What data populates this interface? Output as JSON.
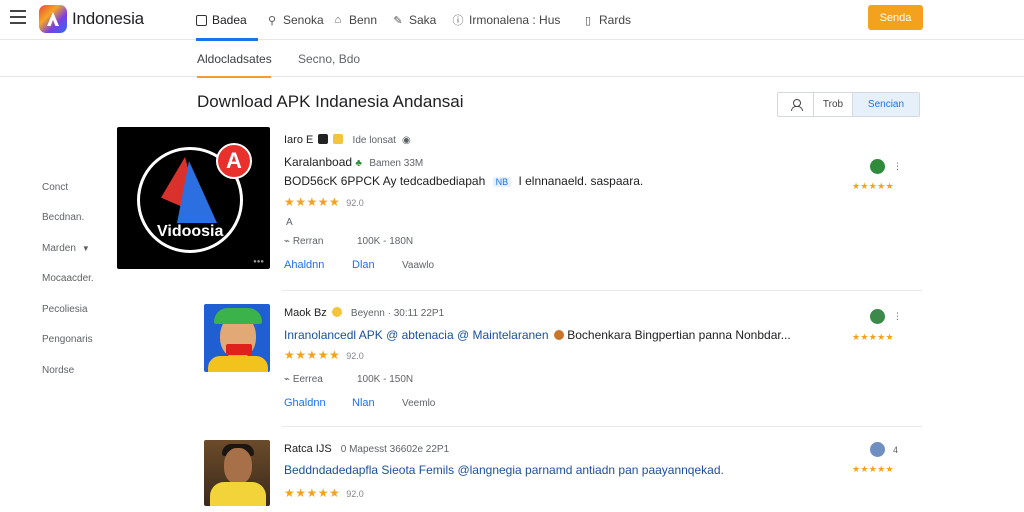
{
  "brand": {
    "name": "Indonesia"
  },
  "nav": {
    "items": [
      {
        "label": "Badea",
        "icon": "box-icon"
      },
      {
        "label": "Senoka",
        "icon": "tag-icon"
      },
      {
        "label": "Benn",
        "icon": "bell-icon"
      },
      {
        "label": "Saka",
        "icon": "pencil-icon"
      },
      {
        "label": "Irmonalena : Hus",
        "icon": "info-icon"
      },
      {
        "label": "Rards",
        "icon": "clipboard-icon"
      }
    ],
    "cta_label": "Senda"
  },
  "subtabs": [
    {
      "label": "Aldocladsates",
      "active": true
    },
    {
      "label": "Secno, Bdo",
      "active": false
    }
  ],
  "page": {
    "title": "Download APK Indanesia Andansai"
  },
  "view_buttons": [
    {
      "label": "",
      "icon": "user-icon"
    },
    {
      "label": "Trob"
    },
    {
      "label": "Sencian"
    }
  ],
  "sidebar": {
    "items": [
      {
        "label": "Conct"
      },
      {
        "label": "Becdnan."
      },
      {
        "label": "Marden",
        "has_caret": true
      },
      {
        "label": "Mocaacder."
      },
      {
        "label": "Pecoliesia"
      },
      {
        "label": "Pengonaris"
      },
      {
        "label": "Nordse"
      }
    ]
  },
  "colors": {
    "accent": "#1a73e8",
    "cta": "#f4a11d",
    "star": "#f4a11d"
  },
  "apps": [
    {
      "thumb_text": "Vidoosia",
      "thumb_badge": "A",
      "header": "Iaro E",
      "header_meta": "Ide lonsat",
      "title_line": "Karalanboad",
      "title_meta": "Bamen 33M",
      "desc": "BOD56cK 6PPCK Ay tedcadbediapah",
      "desc_chip": "NB",
      "desc_tail": "I elnnanaeld. saspaara.",
      "rating": 4.5,
      "rating_text": "★★★★★",
      "rating_num": "92.0",
      "extra_icon": "A",
      "meta_left": "Rerran",
      "meta_right": "100K - 180N",
      "link1": "Ahaldnn",
      "link2": "Dlan",
      "muted": "Vaawlo",
      "right_rating": "★★★★★",
      "right_more": "⋮",
      "avatar_color": "#2f8a3b"
    },
    {
      "header": "Maok Bz",
      "header_meta": "Beyenn · 30:11 22P1",
      "title_line": "Inranolancedl APK @ abtenacia @ Maintelaranen",
      "desc_tail": "Bochenkara Bingpertian panna Nonbdar...",
      "rating": 5,
      "rating_text": "★★★★★",
      "rating_num": "92.0",
      "meta_left": "Eerrea",
      "meta_right": "100K - 150N",
      "link1": "Ghaldnn",
      "link2": "Nlan",
      "muted": "Veemlo",
      "right_rating": "★★★★★",
      "right_more": "⋮",
      "avatar_color": "#3b8a4a"
    },
    {
      "header": "Ratca IJS",
      "header_meta": "0 Mapesst 36602e 22P1",
      "title_line": "Beddndadedapfla Sieota Femils @langnegia parnamd antiadn pan paayannqekad.",
      "rating": 5,
      "rating_text": "★★★★★",
      "rating_num": "92.0",
      "right_rating": "★★★★★",
      "right_more": "4",
      "avatar_color": "#6f8fc0"
    }
  ]
}
